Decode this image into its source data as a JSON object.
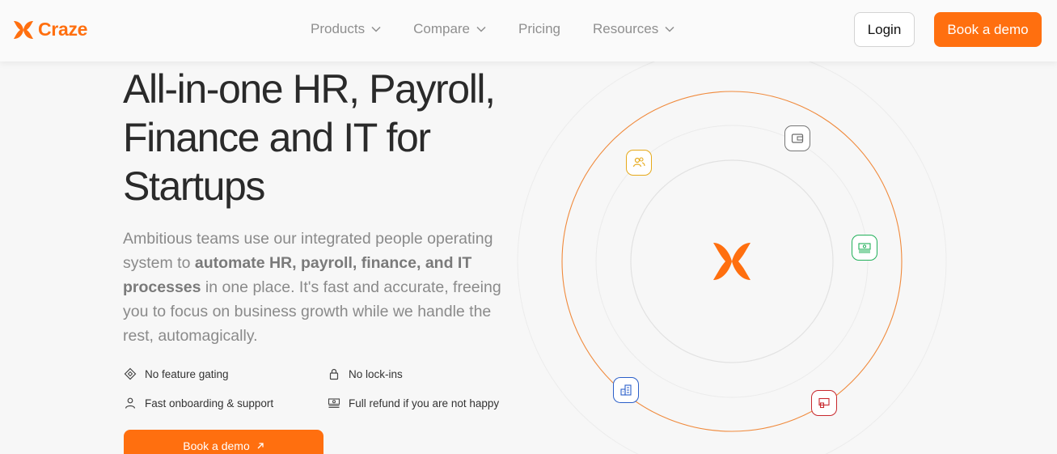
{
  "brand": {
    "name": "Craze",
    "accent": "#ff6f0f"
  },
  "nav": {
    "items": [
      {
        "label": "Products",
        "has_dropdown": true
      },
      {
        "label": "Compare",
        "has_dropdown": true
      },
      {
        "label": "Pricing",
        "has_dropdown": false
      },
      {
        "label": "Resources",
        "has_dropdown": true
      }
    ]
  },
  "header": {
    "login_label": "Login",
    "demo_label": "Book a demo"
  },
  "hero": {
    "headline": "All-in-one HR, Payroll, Finance and IT for Startups",
    "description_lead": "Ambitious teams use our integrated people operating system to ",
    "description_bold": "automate HR, payroll, finance, and IT processes",
    "description_tail": " in one place. It's fast and accurate, freeing you to focus on business growth while we handle the rest, automagically.",
    "features": [
      {
        "label": "No feature gating",
        "icon": "diamond-icon"
      },
      {
        "label": "No lock-ins",
        "icon": "lock-icon"
      },
      {
        "label": "Fast onboarding & support",
        "icon": "user-icon"
      },
      {
        "label": "Full refund if you are not happy",
        "icon": "cash-icon"
      }
    ],
    "cta_label": "Book a demo",
    "cta_icon": "arrow-up-right-icon"
  },
  "orbit": {
    "center_icon": "craze-logo-icon",
    "icons": [
      {
        "name": "people-icon",
        "color": "#e6a91a"
      },
      {
        "name": "wallet-icon",
        "color": "#6b6b6b"
      },
      {
        "name": "money-icon",
        "color": "#22b05a"
      },
      {
        "name": "building-icon",
        "color": "#2b5fc9"
      },
      {
        "name": "presentation-icon",
        "color": "#c8282d"
      }
    ]
  }
}
